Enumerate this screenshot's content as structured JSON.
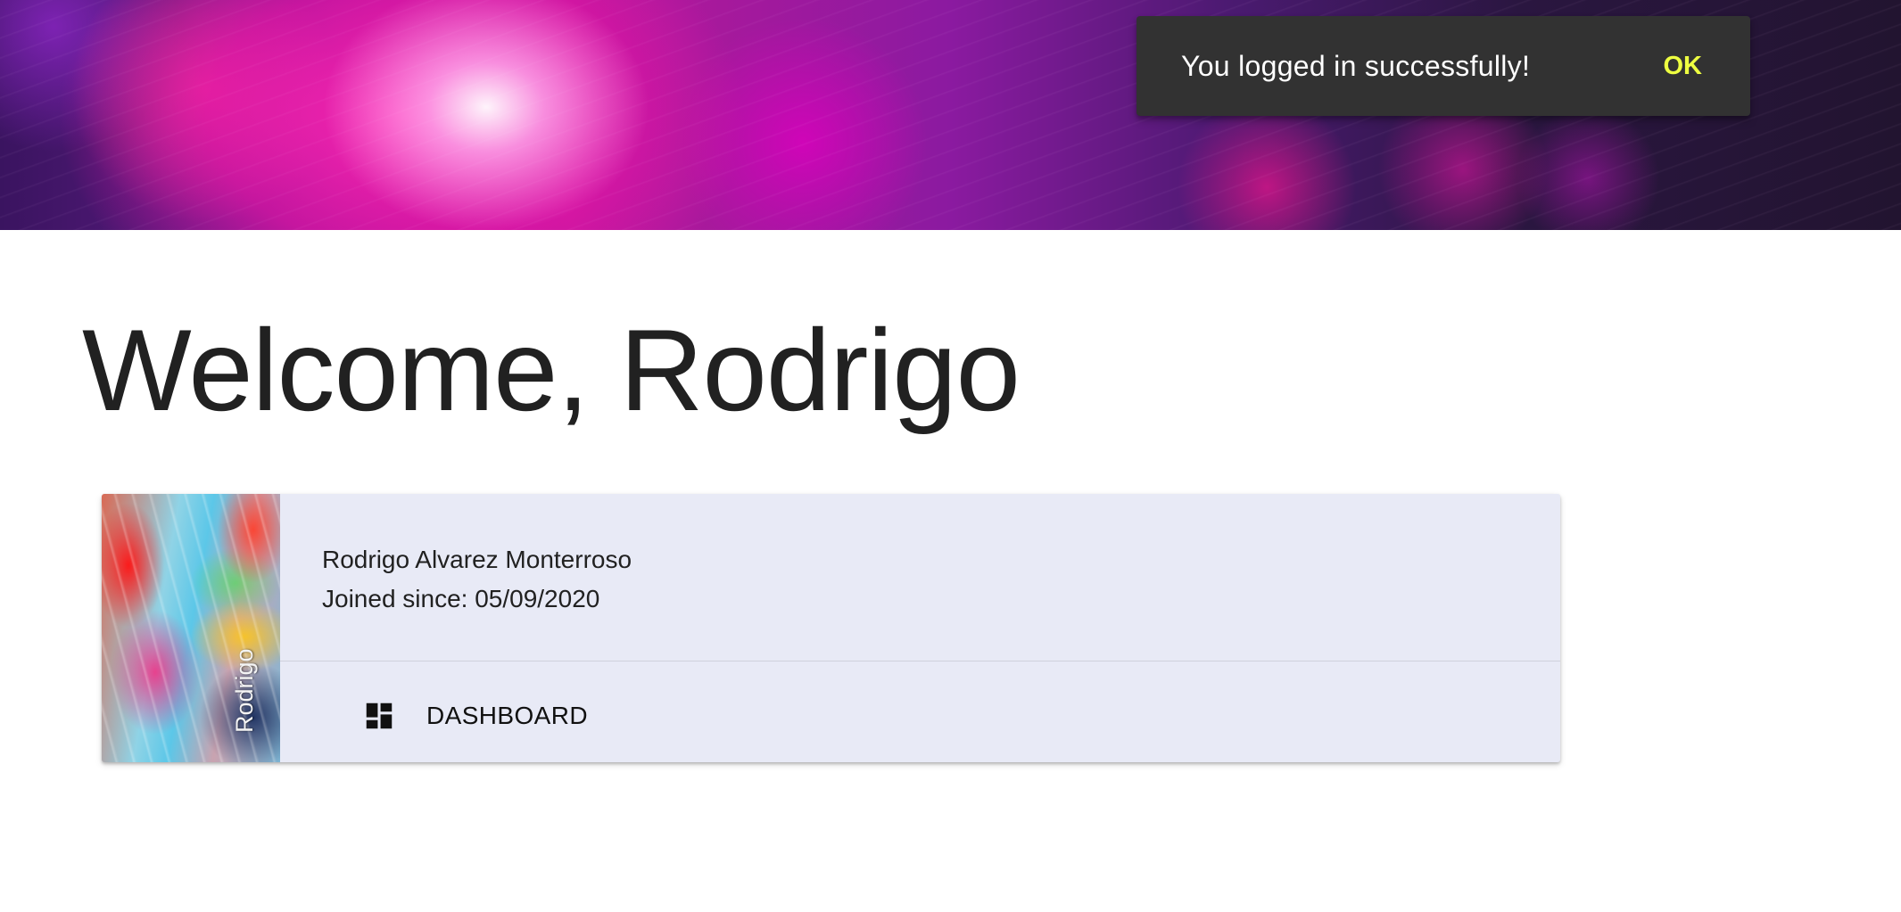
{
  "snackbar": {
    "message": "You logged in successfully!",
    "action_label": "OK",
    "action_color": "#eeff41",
    "background": "#323232"
  },
  "main": {
    "title": "Welcome, Rodrigo"
  },
  "profile_card": {
    "media_label": "Rodrigo",
    "full_name": "Rodrigo Alvarez Monterroso",
    "joined": "Joined since: 05/09/2020",
    "action": {
      "label": "DASHBOARD",
      "icon": "dashboard-icon"
    },
    "background": "#e8eaf6"
  }
}
